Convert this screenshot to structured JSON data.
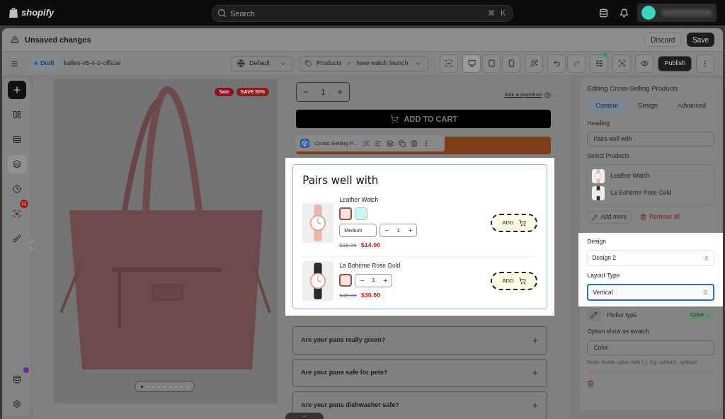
{
  "topbar": {
    "logo": "shopify",
    "search": {
      "placeholder": "Search"
    },
    "shortcut": [
      "⌘",
      "K"
    ]
  },
  "unsaved_bar": {
    "title": "Unsaved changes",
    "buttons": [
      "Discard",
      "Save"
    ]
  },
  "toolbar": {
    "status": "Draft",
    "theme": "kalles-v5-4-2-official",
    "language": "Default",
    "breadcrumb": [
      "Products",
      "New watch launch"
    ],
    "publish": "Publish"
  },
  "rail": {
    "items": [
      {
        "selected": false
      },
      {
        "selected": false
      },
      {
        "selected": true
      },
      {
        "selected": false
      },
      {
        "selected": false,
        "badge": "11"
      },
      {
        "selected": false
      }
    ],
    "bottom_items": [
      {
        "notify": true
      },
      {
        "notify": false
      }
    ]
  },
  "product": {
    "badges": [
      "Sale",
      "SAVE 50%"
    ],
    "slides": [
      {
        "selected": true
      },
      {
        "selected": false
      },
      {
        "selected": false
      },
      {
        "selected": false
      },
      {
        "selected": false
      },
      {
        "selected": false
      },
      {
        "selected": false
      },
      {
        "selected": false
      },
      {
        "selected": false
      }
    ]
  },
  "purchase": {
    "quantity": "1",
    "ask": "Ask a question",
    "add_to_cart": "ADD TO CART"
  },
  "block_toolbar": {
    "label": "Cross-Selling P..."
  },
  "cross_sell": {
    "heading": "Pairs well with",
    "products": [
      {
        "name": "Leather Watch",
        "swatches": [
          {
            "color": "#fde1e1",
            "selected": true
          },
          {
            "color": "#c9f7f1",
            "selected": false
          }
        ],
        "variant": "Medium",
        "quantity": "1",
        "compare_price": "$16.00",
        "price": "$14.00",
        "button": "ADD"
      },
      {
        "name": "La Bohème Rose Gold",
        "swatches": [
          {
            "color": "#fde1e1",
            "selected": true
          }
        ],
        "quantity": "1",
        "compare_price": "$45.00",
        "price": "$30.00",
        "button": "ADD"
      }
    ]
  },
  "faq": [
    "Are your pans really green?",
    "Are your pans safe for pets?",
    "Are your pans dishwasher safe?"
  ],
  "panel": {
    "title": "Editing Cross-Selling Products",
    "tabs": [
      {
        "label": "Content",
        "selected": true
      },
      {
        "label": "Design",
        "selected": false
      },
      {
        "label": "Advanced",
        "selected": false
      }
    ],
    "heading_label": "Heading",
    "heading_value": "Pairs well with",
    "products_label": "Select Products",
    "products": [
      "Leather Watch",
      "La Bohème Rose Gold"
    ],
    "add_more": "Add more",
    "remove_all": "Remove all",
    "design_label": "Design",
    "design_value": "Design 2",
    "layout_label": "Layout Type",
    "layout_value": "Vertical",
    "picker_label": "Picker type",
    "picker_badge": "Color ...",
    "swatch_label": "Option show as swatch",
    "swatch_value": "Color",
    "note": "Note: divide value with (,). Eg: option1, option2"
  }
}
